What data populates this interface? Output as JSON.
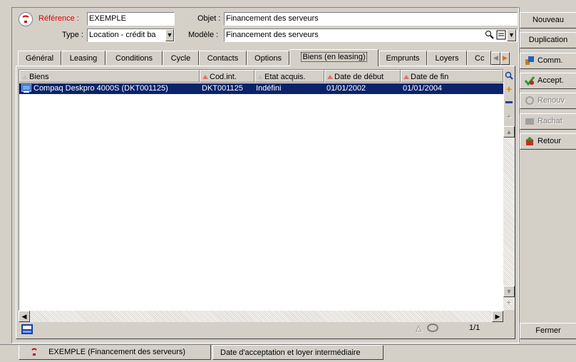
{
  "header": {
    "reference_label": "Référence :",
    "reference_value": "EXEMPLE",
    "type_label": "Type :",
    "type_value": "Location - crédit ba",
    "objet_label": "Objet :",
    "objet_value": "Financement des serveurs",
    "modele_label": "Modèle :",
    "modele_value": "Financement des serveurs"
  },
  "tabs": [
    {
      "label": "Général"
    },
    {
      "label": "Leasing"
    },
    {
      "label": "Conditions"
    },
    {
      "label": "Cycle"
    },
    {
      "label": "Contacts"
    },
    {
      "label": "Options"
    },
    {
      "label": "Biens (en leasing)",
      "active": true
    },
    {
      "label": "Emprunts"
    },
    {
      "label": "Loyers"
    },
    {
      "label": "Cc"
    }
  ],
  "table": {
    "columns": [
      "Biens",
      "Cod.int.",
      "Etat acquis.",
      "Date de début",
      "Date de fin"
    ],
    "rows": [
      {
        "bien": "Compaq Deskpro 4000S (DKT001125)",
        "code": "DKT001125",
        "etat": "Indéfini",
        "debut": "01/01/2002",
        "fin": "01/01/2004"
      }
    ],
    "pager": "1/1"
  },
  "side_buttons": {
    "nouveau": "Nouveau",
    "duplication": "Duplication",
    "comm": "Comm.",
    "accept": "Accept.",
    "renouv": "Renouv",
    "rachat": "Rachat",
    "retour": "Retour",
    "fermer": "Fermer"
  },
  "bottom_tabs": {
    "tab1": "EXEMPLE (Financement des serveurs)",
    "tab2": "Date d'acceptation et loyer intermédiaire"
  },
  "colors": {
    "selection": "#0a246a",
    "required_label": "#e00000",
    "window_bg": "#d4d0c8"
  }
}
